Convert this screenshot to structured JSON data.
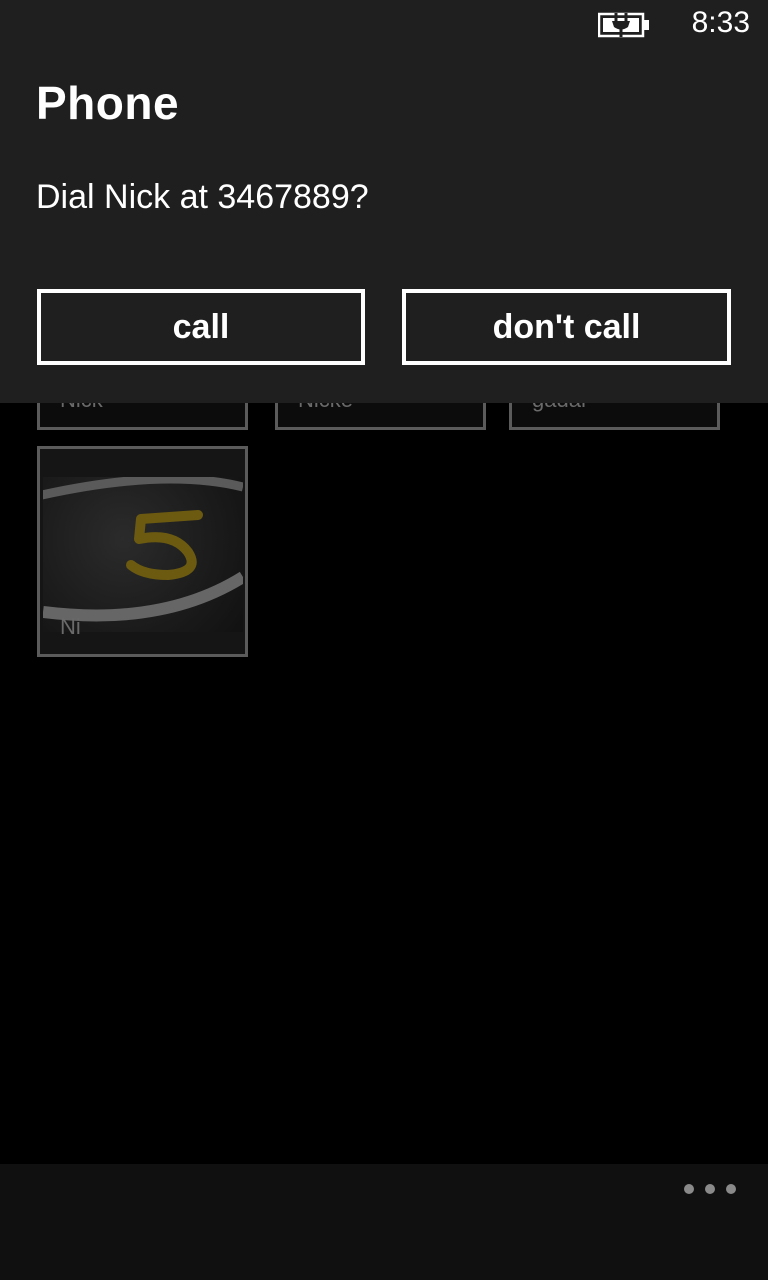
{
  "status_bar": {
    "time": "8:33",
    "battery_icon": "battery-charging-icon"
  },
  "dialog": {
    "title": "Phone",
    "message": "Dial Nick at 3467889?",
    "call_label": "call",
    "dont_call_label": "don't call"
  },
  "contacts": [
    {
      "label": "Nick"
    },
    {
      "label": "Nicke"
    },
    {
      "label": "gadar"
    },
    {
      "label": "Ni"
    }
  ],
  "app_bar": {
    "more_icon": "ellipsis-icon"
  }
}
